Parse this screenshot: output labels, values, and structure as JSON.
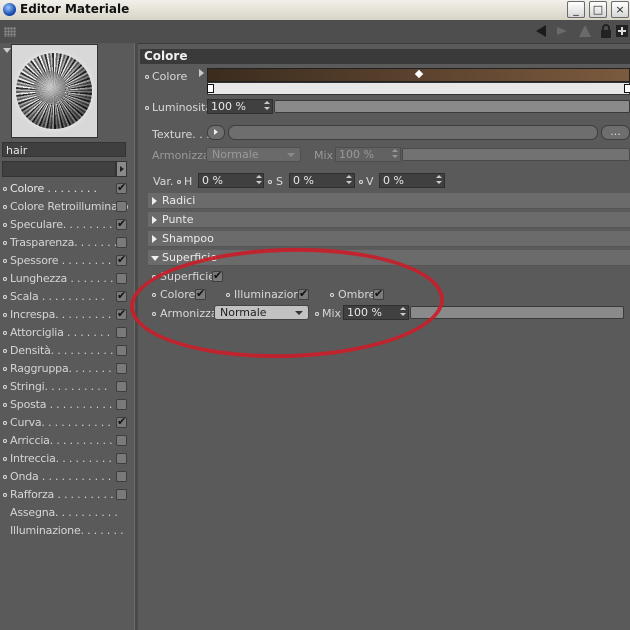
{
  "window": {
    "title": "Editor Materiale",
    "controls": [
      "_",
      "□",
      "×"
    ]
  },
  "toolbar": {
    "icons": [
      "back-arrow-icon",
      "forward-arrow-icon",
      "up-arrow-icon",
      "lock-icon",
      "new-window-icon"
    ]
  },
  "material": {
    "name": "hair"
  },
  "channels": [
    {
      "label": "Colore . . . . . . . .",
      "checked": true,
      "dot": true
    },
    {
      "label": "Colore Retroilluminato",
      "checked": false,
      "dot": true
    },
    {
      "label": "Speculare. . . . . . . .",
      "checked": true,
      "dot": true
    },
    {
      "label": "Trasparenza. . . . . . .",
      "checked": false,
      "dot": true
    },
    {
      "label": "Spessore . . . . . . . .",
      "checked": true,
      "dot": true
    },
    {
      "label": "Lunghezza . . . . . . .",
      "checked": false,
      "dot": true
    },
    {
      "label": "Scala . . . . . . . . . .",
      "checked": true,
      "dot": true
    },
    {
      "label": "Increspa. . . . . . . . .",
      "checked": true,
      "dot": true
    },
    {
      "label": "Attorciglia . . . . . . .",
      "checked": false,
      "dot": true
    },
    {
      "label": "Densità. . . . . . . . . .",
      "checked": false,
      "dot": true
    },
    {
      "label": "Raggruppa. . . . . . . .",
      "checked": false,
      "dot": true
    },
    {
      "label": "Stringi. . . . . . . . . .",
      "checked": false,
      "dot": true
    },
    {
      "label": "Sposta . . . . . . . . . .",
      "checked": false,
      "dot": true
    },
    {
      "label": "Curva. . . . . . . . . . .",
      "checked": true,
      "dot": true
    },
    {
      "label": "Arriccia. . . . . . . . . .",
      "checked": false,
      "dot": true
    },
    {
      "label": "Intreccia. . . . . . . . .",
      "checked": false,
      "dot": true
    },
    {
      "label": "Onda . . . . . . . . . . .",
      "checked": false,
      "dot": true
    },
    {
      "label": "Rafforza . . . . . . . . .",
      "checked": false,
      "dot": true
    },
    {
      "label": "Assegna. . . . . . . . . .",
      "checked": null,
      "dot": false
    },
    {
      "label": "Illuminazione. . . . . . .",
      "checked": null,
      "dot": false
    }
  ],
  "colore": {
    "header": "Colore",
    "color_label": "Colore",
    "luminosita_label": "Luminosità",
    "luminosita_value": "100 %",
    "texture_label": "Texture. . .",
    "texture_more": "...",
    "armonizza_label": "Armonizza",
    "armonizza_value": "Normale",
    "mix_label": "Mix",
    "mix_value": "100 %",
    "var_label": "Var.",
    "h_label": "H",
    "h_value": "0 %",
    "s_label": "S",
    "s_value": "0 %",
    "v_label": "V",
    "v_value": "0 %"
  },
  "groups": {
    "radici": "Radici",
    "punte": "Punte",
    "shampoo": "Shampoo",
    "superficie": "Superficie"
  },
  "superficie": {
    "superficie_label": "Superficie",
    "superficie_checked": true,
    "colore_label": "Colore",
    "colore_checked": true,
    "illuminazione_label": "Illuminazione",
    "illuminazione_checked": true,
    "ombre_label": "Ombre",
    "ombre_checked": true,
    "armonizza_label": "Armonizza",
    "armonizza_value": "Normale",
    "mix_label": "Mix",
    "mix_value": "100 %"
  },
  "colors": {
    "gradient_start": "#3b2c1e",
    "gradient_end": "#7b5a3e",
    "annotation": "#c8202a"
  }
}
